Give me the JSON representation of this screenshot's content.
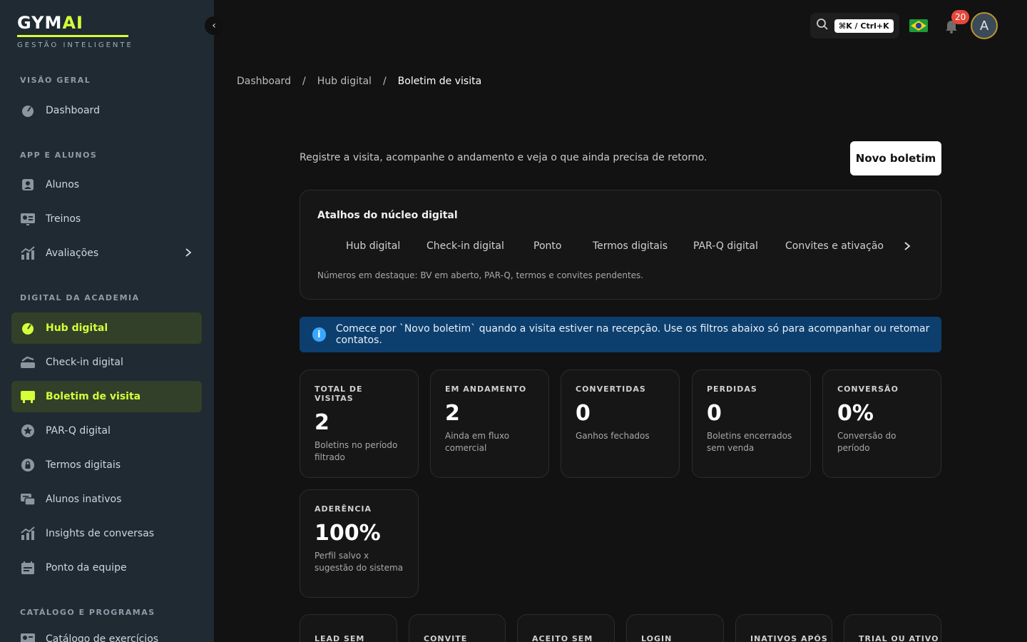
{
  "brand": {
    "name_main": "GYM",
    "name_accent": "AI",
    "tagline": "GESTÃO INTELIGENTE",
    "accent_color": "#d4ff3a"
  },
  "sidebar": {
    "sections": [
      {
        "label": "VISÃO GERAL"
      },
      {
        "label": "APP E ALUNOS"
      },
      {
        "label": "DIGITAL DA ACADEMIA"
      },
      {
        "label": "CATÁLOGO E PROGRAMAS"
      }
    ],
    "items": [
      {
        "label": "Dashboard",
        "icon": "dashboard-icon"
      },
      {
        "label": "Alunos",
        "icon": "user-icon"
      },
      {
        "label": "Treinos",
        "icon": "workout-icon"
      },
      {
        "label": "Avaliações",
        "icon": "chart-icon"
      },
      {
        "label": "Hub digital",
        "icon": "hub-icon",
        "active": true
      },
      {
        "label": "Check-in digital",
        "icon": "checkin-icon"
      },
      {
        "label": "Boletim de visita",
        "icon": "report-icon",
        "active": true
      },
      {
        "label": "PAR-Q digital",
        "icon": "star-icon"
      },
      {
        "label": "Termos digitais",
        "icon": "lock-icon"
      },
      {
        "label": "Alunos inativos",
        "icon": "chat-icon"
      },
      {
        "label": "Insights de conversas",
        "icon": "chart-icon"
      },
      {
        "label": "Ponto da equipe",
        "icon": "calendar-icon"
      },
      {
        "label": "Catálogo de exercícios",
        "icon": "catalog-icon"
      }
    ]
  },
  "topbar": {
    "shortcut": "⌘K / Ctrl+K",
    "notifications": "20",
    "avatar_initial": "A"
  },
  "breadcrumb": {
    "items": [
      "Dashboard",
      "Hub digital",
      "Boletim de visita"
    ],
    "separator": "/"
  },
  "main": {
    "intro": "Registre a visita, acompanhe o andamento e veja o que ainda precisa de retorno.",
    "new_button": "Novo boletim",
    "shortcuts": {
      "title": "Atalhos do núcleo digital",
      "items": [
        "Hub digital",
        "Check-in digital",
        "Ponto",
        "Termos digitais",
        "PAR-Q digital",
        "Convites e ativação"
      ],
      "note": "Números em destaque: BV em aberto, PAR-Q, termos e convites pendentes."
    },
    "info": "Comece por `Novo boletim` quando a visita estiver na recepção. Use os filtros abaixo só para acompanhar ou retomar contatos.",
    "stats": [
      {
        "label": "TOTAL DE VISITAS",
        "value": "2",
        "desc": "Boletins no período filtrado"
      },
      {
        "label": "EM ANDAMENTO",
        "value": "2",
        "desc": "Ainda em fluxo comercial"
      },
      {
        "label": "CONVERTIDAS",
        "value": "0",
        "desc": "Ganhos fechados"
      },
      {
        "label": "PERDIDAS",
        "value": "0",
        "desc": "Boletins encerrados sem venda"
      },
      {
        "label": "CONVERSÃO",
        "value": "0%",
        "desc": "Conversão do período"
      },
      {
        "label": "ADERÊNCIA",
        "value": "100%",
        "desc": "Perfil salvo x sugestão do sistema"
      }
    ],
    "mini_cards": [
      "LEAD SEM",
      "CONVITE",
      "ACEITO SEM",
      "LOGIN",
      "INATIVOS APÓS",
      "TRIAL OU ATIVO"
    ]
  }
}
